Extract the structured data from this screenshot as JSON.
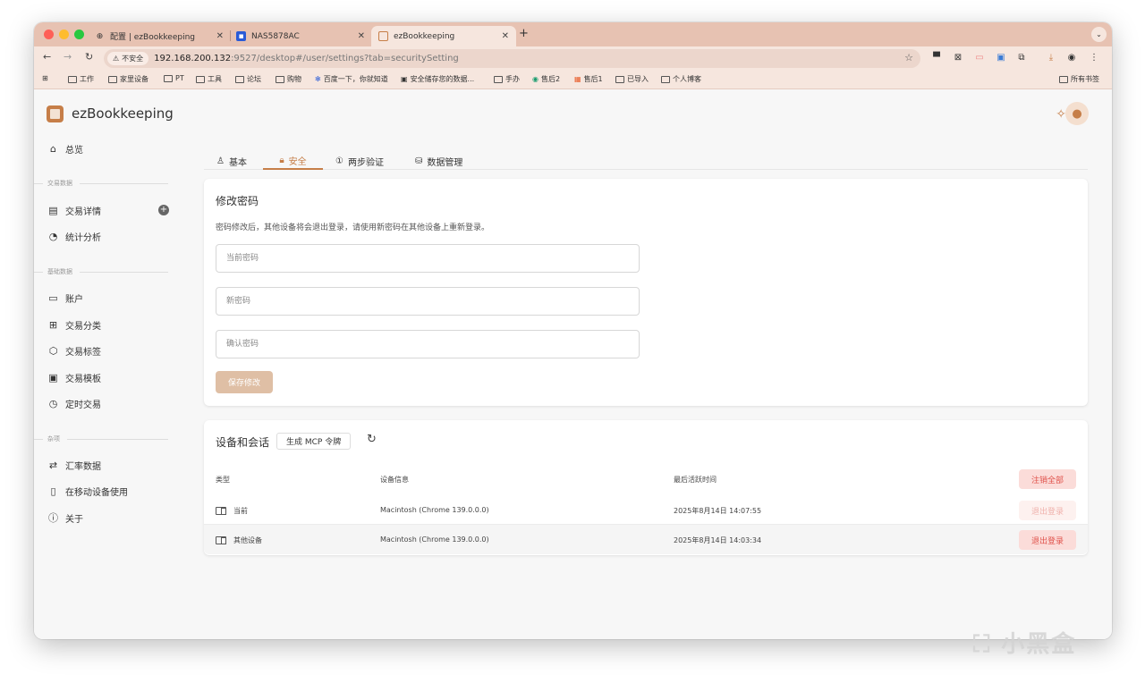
{
  "browser": {
    "tabs": [
      {
        "title": "配置 | ezBookkeeping",
        "icon": "globe-icon"
      },
      {
        "title": "NAS5878AC",
        "icon": "nas-icon"
      },
      {
        "title": "ezBookkeeping",
        "icon": "ezbookkeeping-icon"
      }
    ],
    "new_tab": "+",
    "address": {
      "security_label": "不安全",
      "host": "192.168.200.132",
      "path": ":9527/desktop#/user/settings?tab=securitySetting"
    },
    "bookmarks": [
      {
        "label": "工作"
      },
      {
        "label": "家里设备"
      },
      {
        "label": "PT"
      },
      {
        "label": "工具"
      },
      {
        "label": "论坛"
      },
      {
        "label": "购物"
      },
      {
        "label": "百度一下，你就知道"
      },
      {
        "label": "安全储存您的数据..."
      },
      {
        "label": "手办"
      },
      {
        "label": "售后2"
      },
      {
        "label": "售后1"
      },
      {
        "label": "已导入"
      },
      {
        "label": "个人博客"
      }
    ],
    "all_bookmarks": "所有书签"
  },
  "app": {
    "title": "ezBookkeeping",
    "accent": "#c67e48"
  },
  "sidebar": {
    "overview": "总览",
    "sections": {
      "transaction_data": "交易数据",
      "basic_data": "基础数据",
      "misc": "杂项"
    },
    "items": {
      "transaction_details": "交易详情",
      "statistics": "统计分析",
      "accounts": "账户",
      "categories": "交易分类",
      "tags": "交易标签",
      "templates": "交易模板",
      "scheduled": "定时交易",
      "exchange_rates": "汇率数据",
      "mobile": "在移动设备使用",
      "about": "关于"
    }
  },
  "settings_tabs": {
    "basic": "基本",
    "security": "安全",
    "two_factor": "两步验证",
    "data_management": "数据管理"
  },
  "password_card": {
    "title": "修改密码",
    "description": "密码修改后，其他设备将会退出登录，请使用新密码在其他设备上重新登录。",
    "current_placeholder": "当前密码",
    "new_placeholder": "新密码",
    "confirm_placeholder": "确认密码",
    "save_label": "保存修改"
  },
  "sessions_card": {
    "title": "设备和会话",
    "mcp_label": "生成 MCP 令牌",
    "columns": {
      "type": "类型",
      "device_info": "设备信息",
      "last_active": "最后活跃时间"
    },
    "logout_all": "注销全部",
    "rows": [
      {
        "type": "当前",
        "device": "Macintosh (Chrome 139.0.0.0)",
        "time": "2025年8月14日 14:07:55",
        "action": "退出登录"
      },
      {
        "type": "其他设备",
        "device": "Macintosh (Chrome 139.0.0.0)",
        "time": "2025年8月14日 14:03:34",
        "action": "退出登录"
      }
    ]
  },
  "watermark": "小黑盒"
}
